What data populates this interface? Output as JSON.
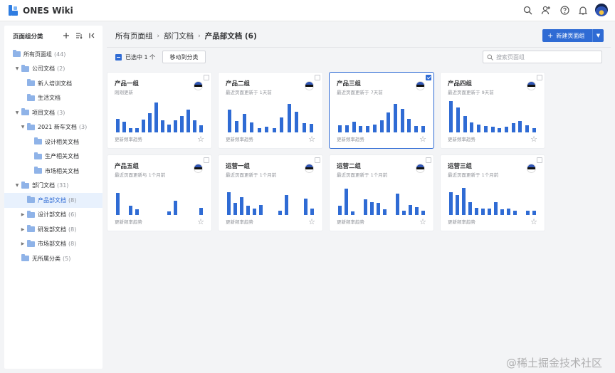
{
  "app": {
    "title": "ONES Wiki"
  },
  "topbar": {
    "icons": [
      "search-icon",
      "add-user-icon",
      "help-icon",
      "bell-icon",
      "avatar"
    ]
  },
  "sidebar": {
    "title": "页面组分类",
    "tools": [
      "plus-icon",
      "sort-icon",
      "collapse-icon"
    ],
    "items": [
      {
        "label": "所有页面组",
        "count": "(44)",
        "depth": 0,
        "arrow": "",
        "active": false
      },
      {
        "label": "公司文档",
        "count": "(2)",
        "depth": 1,
        "arrow": "▼",
        "active": false
      },
      {
        "label": "新人培训文档",
        "count": "",
        "depth": 2,
        "arrow": "",
        "active": false
      },
      {
        "label": "生活文档",
        "count": "",
        "depth": 2,
        "arrow": "",
        "active": false
      },
      {
        "label": "项目文档",
        "count": "(3)",
        "depth": 1,
        "arrow": "▼",
        "active": false
      },
      {
        "label": "2021 新车文档",
        "count": "(3)",
        "depth": 2,
        "arrow": "▼",
        "active": false
      },
      {
        "label": "设计相关文档",
        "count": "",
        "depth": 3,
        "arrow": "",
        "active": false
      },
      {
        "label": "生产相关文档",
        "count": "",
        "depth": 3,
        "arrow": "",
        "active": false
      },
      {
        "label": "市场相关文档",
        "count": "",
        "depth": 3,
        "arrow": "",
        "active": false
      },
      {
        "label": "部门文档",
        "count": "(31)",
        "depth": 1,
        "arrow": "▼",
        "active": false
      },
      {
        "label": "产品部文档",
        "count": "(8)",
        "depth": 2,
        "arrow": "",
        "active": true
      },
      {
        "label": "设计部文档",
        "count": "(6)",
        "depth": 2,
        "arrow": "▶",
        "active": false
      },
      {
        "label": "研发部文档",
        "count": "(8)",
        "depth": 2,
        "arrow": "▶",
        "active": false
      },
      {
        "label": "市场部文档",
        "count": "(8)",
        "depth": 2,
        "arrow": "▶",
        "active": false
      },
      {
        "label": "无所属分类",
        "count": "(5)",
        "depth": 1,
        "arrow": "",
        "active": false
      }
    ]
  },
  "breadcrumb": {
    "items": [
      "所有页面组",
      "部门文档"
    ],
    "current": "产品部文档 (6)"
  },
  "new_button": {
    "label": "新建页面组"
  },
  "toolbar": {
    "selected_text": "已选中 1 个",
    "move_label": "移动到分类"
  },
  "search": {
    "placeholder": "搜索页面组",
    "value": ""
  },
  "cards": [
    {
      "title": "产品一组",
      "subtitle": "刚刚更新",
      "footer": "更新频率趋势",
      "checked": false,
      "values": [
        0.42,
        0.32,
        0.12,
        0.14,
        0.4,
        0.58,
        0.92,
        0.38,
        0.24,
        0.38,
        0.5,
        0.7,
        0.36,
        0.22
      ]
    },
    {
      "title": "产品二组",
      "subtitle": "最近页面更新于 1天前",
      "footer": "更新频率趋势",
      "checked": false,
      "values": [
        0.7,
        0.34,
        0.56,
        0.3,
        0.12,
        0.18,
        0.14,
        0.46,
        0.86,
        0.62,
        0.28,
        0.26
      ]
    },
    {
      "title": "产品三组",
      "subtitle": "最近页面更新于 7天前",
      "footer": "更新频率趋势",
      "checked": true,
      "values": [
        0.22,
        0.22,
        0.32,
        0.2,
        0.2,
        0.24,
        0.36,
        0.6,
        0.86,
        0.72,
        0.42,
        0.2,
        0.2
      ]
    },
    {
      "title": "产品四组",
      "subtitle": "最近页面更新于 9天前",
      "footer": "更新频率趋势",
      "checked": false,
      "values": [
        0.96,
        0.76,
        0.5,
        0.3,
        0.24,
        0.2,
        0.18,
        0.14,
        0.18,
        0.28,
        0.34,
        0.22,
        0.12
      ]
    },
    {
      "title": "产品五组",
      "subtitle": "最近页面更新与 1个月前",
      "footer": "更新频率趋势",
      "checked": false,
      "values": [
        0.68,
        0,
        0.28,
        0.18,
        0,
        0,
        0,
        0,
        0.1,
        0.44,
        0,
        0,
        0,
        0.22
      ]
    },
    {
      "title": "运营一组",
      "subtitle": "最近页面更新于 1个月前",
      "footer": "更新频率趋势",
      "checked": false,
      "values": [
        0.7,
        0.36,
        0.54,
        0.28,
        0.2,
        0.3,
        0,
        0,
        0.14,
        0.6,
        0,
        0,
        0.5,
        0.2
      ]
    },
    {
      "title": "运营二组",
      "subtitle": "最近页面更新于 1个月前",
      "footer": "更新频率趋势",
      "checked": false,
      "values": [
        0.28,
        0.8,
        0.1,
        0,
        0.48,
        0.4,
        0.38,
        0.18,
        0,
        0.66,
        0.14,
        0.3,
        0.24,
        0.12
      ]
    },
    {
      "title": "运营三组",
      "subtitle": "最近页面更新于 1个月前",
      "footer": "更新频率趋势",
      "checked": false,
      "values": [
        0.7,
        0.6,
        0.82,
        0.4,
        0.22,
        0.2,
        0.2,
        0.4,
        0.18,
        0.2,
        0.12,
        0,
        0.12,
        0.14
      ]
    }
  ],
  "watermark": "@稀土掘金技术社区",
  "colors": {
    "accent": "#2f6bd4",
    "folder": "#8fb3e8",
    "active_bg": "#e8f1fd"
  }
}
